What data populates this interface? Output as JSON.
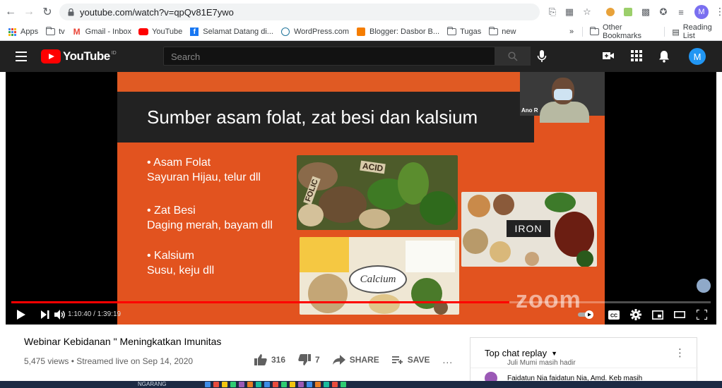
{
  "browser": {
    "url": "youtube.com/watch?v=qpQv81E7ywo",
    "profile_initial": "M",
    "bookmarks": [
      {
        "label": "Apps",
        "icon": "apps-grid-icon"
      },
      {
        "label": "tv",
        "icon": "folder-icon"
      },
      {
        "label": "Gmail - Inbox",
        "icon": "gmail-icon"
      },
      {
        "label": "YouTube",
        "icon": "youtube-icon"
      },
      {
        "label": "Selamat Datang di...",
        "icon": "facebook-icon"
      },
      {
        "label": "WordPress.com",
        "icon": "wordpress-icon"
      },
      {
        "label": "Blogger: Dasbor B...",
        "icon": "blogger-icon"
      },
      {
        "label": "Tugas",
        "icon": "folder-icon"
      },
      {
        "label": "new",
        "icon": "folder-icon"
      }
    ],
    "bookmarks_overflow": "»",
    "other_bookmarks": "Other Bookmarks",
    "reading_list": "Reading List"
  },
  "youtube": {
    "logo_text": "YouTube",
    "logo_country": "ID",
    "search_placeholder": "Search",
    "avatar_initial": "M"
  },
  "video": {
    "slide_title": "Sumber asam folat, zat besi dan kalsium",
    "bullets": [
      {
        "head": "• Asam Folat",
        "sub": "Sayuran Hijau, telur dll"
      },
      {
        "head": "• Zat Besi",
        "sub": "Daging merah, bayam dll"
      },
      {
        "head": "• Kalsium",
        "sub": "Susu, keju dll"
      }
    ],
    "image_labels": {
      "folic": "FOLIC",
      "acid": "ACID",
      "iron": "IRON",
      "calcium": "Calcium"
    },
    "webcam_name": "Ano R",
    "watermark": "zoom",
    "time_current": "1:10:40",
    "time_total": "1:39:19",
    "time_separator": "/",
    "progress": 0.712
  },
  "info": {
    "title": "Webinar Kebidanan \" Meningkatkan Imunitas",
    "views": "5,475 views",
    "streamed": "Streamed live on Sep 14, 2020",
    "meta_sep": "•",
    "likes": "316",
    "dislikes": "7",
    "share_label": "SHARE",
    "save_label": "SAVE",
    "more": "..."
  },
  "chat": {
    "header": "Top chat replay",
    "msg1": "Juli Mumi  masih hadir",
    "msg2": "Faidatun Nia  faidatun Nia, Amd. Keb masih"
  },
  "taskbar": {
    "label": "NGARANG"
  },
  "colors": {
    "youtube_red": "#ff0000",
    "slide_orange": "#e2531f",
    "header_bg": "#212121",
    "progress_red": "#ff0000"
  }
}
